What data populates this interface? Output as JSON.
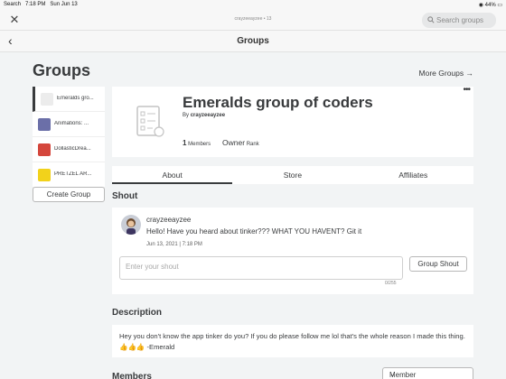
{
  "status_bar": {
    "carrier": "Search",
    "time": "7:18 PM",
    "date": "Sun Jun 13",
    "battery": "44%"
  },
  "browser": {
    "url": "crayzeeayzee • 13",
    "search_placeholder": "Search groups"
  },
  "header": {
    "title": "Groups"
  },
  "page": {
    "title": "Groups",
    "more_groups": "More Groups →"
  },
  "sidebar": {
    "groups": [
      {
        "name": "Emeralds gro...",
        "thumb_color": "#ececec"
      },
      {
        "name": "Animations: ...",
        "thumb_color": "#6b6fa8"
      },
      {
        "name": "DollasticDrea...",
        "thumb_color": "#d4463c"
      },
      {
        "name": "PRETZEL AR...",
        "thumb_color": "#f2d21b"
      }
    ],
    "create_button": "Create Group"
  },
  "group": {
    "name": "Emeralds group of coders",
    "by_prefix": "By",
    "owner_name": "crayzeeayzee",
    "member_count": "1",
    "members_label": "Members",
    "rank_value": "Owner",
    "rank_label": "Rank"
  },
  "tabs": [
    "About",
    "Store",
    "Affiliates"
  ],
  "shout": {
    "section_title": "Shout",
    "username": "crayzeeayzee",
    "message": "Hello! Have you heard about tinker??? WHAT YOU HAVENT? Git it",
    "date": "Jun 13, 2021 | 7:18 PM",
    "input_placeholder": "Enter your shout",
    "button": "Group Shout",
    "counter": "0/255"
  },
  "description": {
    "section_title": "Description",
    "text": "Hey you don't know the app tinker do you? If you do please follow me lol that's the whole reason I made this thing. 👍👍👍 -Emerald"
  },
  "members": {
    "section_title": "Members",
    "dropdown_value": "Member"
  }
}
